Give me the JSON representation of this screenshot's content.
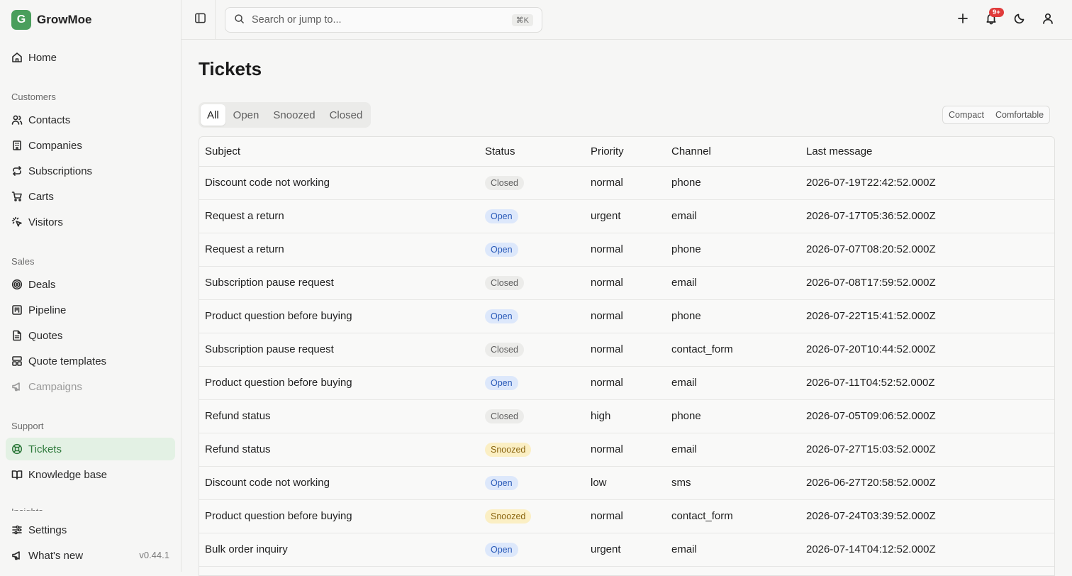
{
  "app": {
    "brand_letter": "G",
    "brand_name": "GrowMoe",
    "version": "v0.44.1"
  },
  "sidebar": {
    "home": "Home",
    "sections": {
      "customers": "Customers",
      "sales": "Sales",
      "support": "Support",
      "insights": "Insights"
    },
    "customers": [
      "Contacts",
      "Companies",
      "Subscriptions",
      "Carts",
      "Visitors"
    ],
    "sales": [
      "Deals",
      "Pipeline",
      "Quotes",
      "Quote templates",
      "Campaigns"
    ],
    "support": [
      "Tickets",
      "Knowledge base"
    ],
    "footer": {
      "settings": "Settings",
      "whats_new": "What's new"
    }
  },
  "search": {
    "placeholder": "Search or jump to...",
    "shortcut": "⌘K"
  },
  "notifications": {
    "count": "9+"
  },
  "page": {
    "title": "Tickets"
  },
  "tabs": [
    "All",
    "Open",
    "Snoozed",
    "Closed"
  ],
  "density": {
    "compact": "Compact",
    "comfortable": "Comfortable"
  },
  "table": {
    "headers": {
      "subject": "Subject",
      "status": "Status",
      "priority": "Priority",
      "channel": "Channel",
      "last_message": "Last message"
    },
    "rows": [
      {
        "subject": "Discount code not working",
        "status": "Closed",
        "priority": "normal",
        "channel": "phone",
        "last": "2026-07-19T22:42:52.000Z"
      },
      {
        "subject": "Request a return",
        "status": "Open",
        "priority": "urgent",
        "channel": "email",
        "last": "2026-07-17T05:36:52.000Z"
      },
      {
        "subject": "Request a return",
        "status": "Open",
        "priority": "normal",
        "channel": "phone",
        "last": "2026-07-07T08:20:52.000Z"
      },
      {
        "subject": "Subscription pause request",
        "status": "Closed",
        "priority": "normal",
        "channel": "email",
        "last": "2026-07-08T17:59:52.000Z"
      },
      {
        "subject": "Product question before buying",
        "status": "Open",
        "priority": "normal",
        "channel": "phone",
        "last": "2026-07-22T15:41:52.000Z"
      },
      {
        "subject": "Subscription pause request",
        "status": "Closed",
        "priority": "normal",
        "channel": "contact_form",
        "last": "2026-07-20T10:44:52.000Z"
      },
      {
        "subject": "Product question before buying",
        "status": "Open",
        "priority": "normal",
        "channel": "email",
        "last": "2026-07-11T04:52:52.000Z"
      },
      {
        "subject": "Refund status",
        "status": "Closed",
        "priority": "high",
        "channel": "phone",
        "last": "2026-07-05T09:06:52.000Z"
      },
      {
        "subject": "Refund status",
        "status": "Snoozed",
        "priority": "normal",
        "channel": "email",
        "last": "2026-07-27T15:03:52.000Z"
      },
      {
        "subject": "Discount code not working",
        "status": "Open",
        "priority": "low",
        "channel": "sms",
        "last": "2026-06-27T20:58:52.000Z"
      },
      {
        "subject": "Product question before buying",
        "status": "Snoozed",
        "priority": "normal",
        "channel": "contact_form",
        "last": "2026-07-24T03:39:52.000Z"
      },
      {
        "subject": "Bulk order inquiry",
        "status": "Open",
        "priority": "urgent",
        "channel": "email",
        "last": "2026-07-14T04:12:52.000Z"
      }
    ]
  },
  "colors": {
    "brand": "#4a9e5c",
    "active_nav_bg": "#e3f1e4",
    "badge": "#e03b3b"
  }
}
